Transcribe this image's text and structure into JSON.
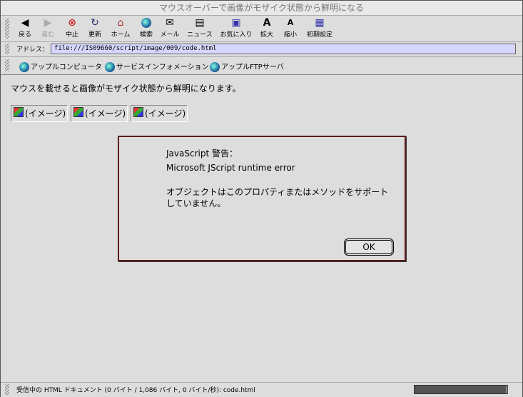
{
  "window": {
    "title": "マウスオーバーで画像がモザイク状態から鮮明になる"
  },
  "toolbar": {
    "buttons": [
      {
        "label": "戻る",
        "icon": "back-arrow-icon",
        "enabled": true
      },
      {
        "label": "進む",
        "icon": "forward-arrow-icon",
        "enabled": false
      },
      {
        "label": "中止",
        "icon": "stop-icon",
        "enabled": true
      },
      {
        "label": "更新",
        "icon": "refresh-icon",
        "enabled": true
      },
      {
        "label": "ホーム",
        "icon": "home-icon",
        "enabled": true
      },
      {
        "label": "検索",
        "icon": "search-globe-icon",
        "enabled": true
      },
      {
        "label": "メール",
        "icon": "mail-icon",
        "enabled": true
      },
      {
        "label": "ニュース",
        "icon": "news-icon",
        "enabled": true
      },
      {
        "label": "お気に入り",
        "icon": "favorites-icon",
        "enabled": true
      },
      {
        "label": "拡大",
        "icon": "text-larger-icon",
        "enabled": true
      },
      {
        "label": "縮小",
        "icon": "text-smaller-icon",
        "enabled": true
      },
      {
        "label": "初期設定",
        "icon": "preferences-icon",
        "enabled": true
      }
    ]
  },
  "address": {
    "label": "アドレス：",
    "value": "file:///IS09660/script/image/009/code.html"
  },
  "favorites": [
    {
      "label": "アップルコンピュータ"
    },
    {
      "label": "サービスインフォメーション"
    },
    {
      "label": "アップルFTPサーバ"
    }
  ],
  "content": {
    "intro": "マウスを載せると画像がモザイク状態から鮮明になります。",
    "images": [
      {
        "alt": "(イメージ)"
      },
      {
        "alt": "(イメージ)"
      },
      {
        "alt": "(イメージ)"
      }
    ]
  },
  "dialog": {
    "title": "JavaScript 警告：",
    "error": "Microsoft JScript runtime error",
    "message_line1": "オブジェクトはこのプロパティまたはメソッドをサポート",
    "message_line2": "していません。",
    "ok_label": "OK"
  },
  "status": {
    "text": "受信中の HTML ドキュメント (0 バイト / 1,086 バイト, 0 バイト/秒): code.html",
    "progress": 0.99
  }
}
